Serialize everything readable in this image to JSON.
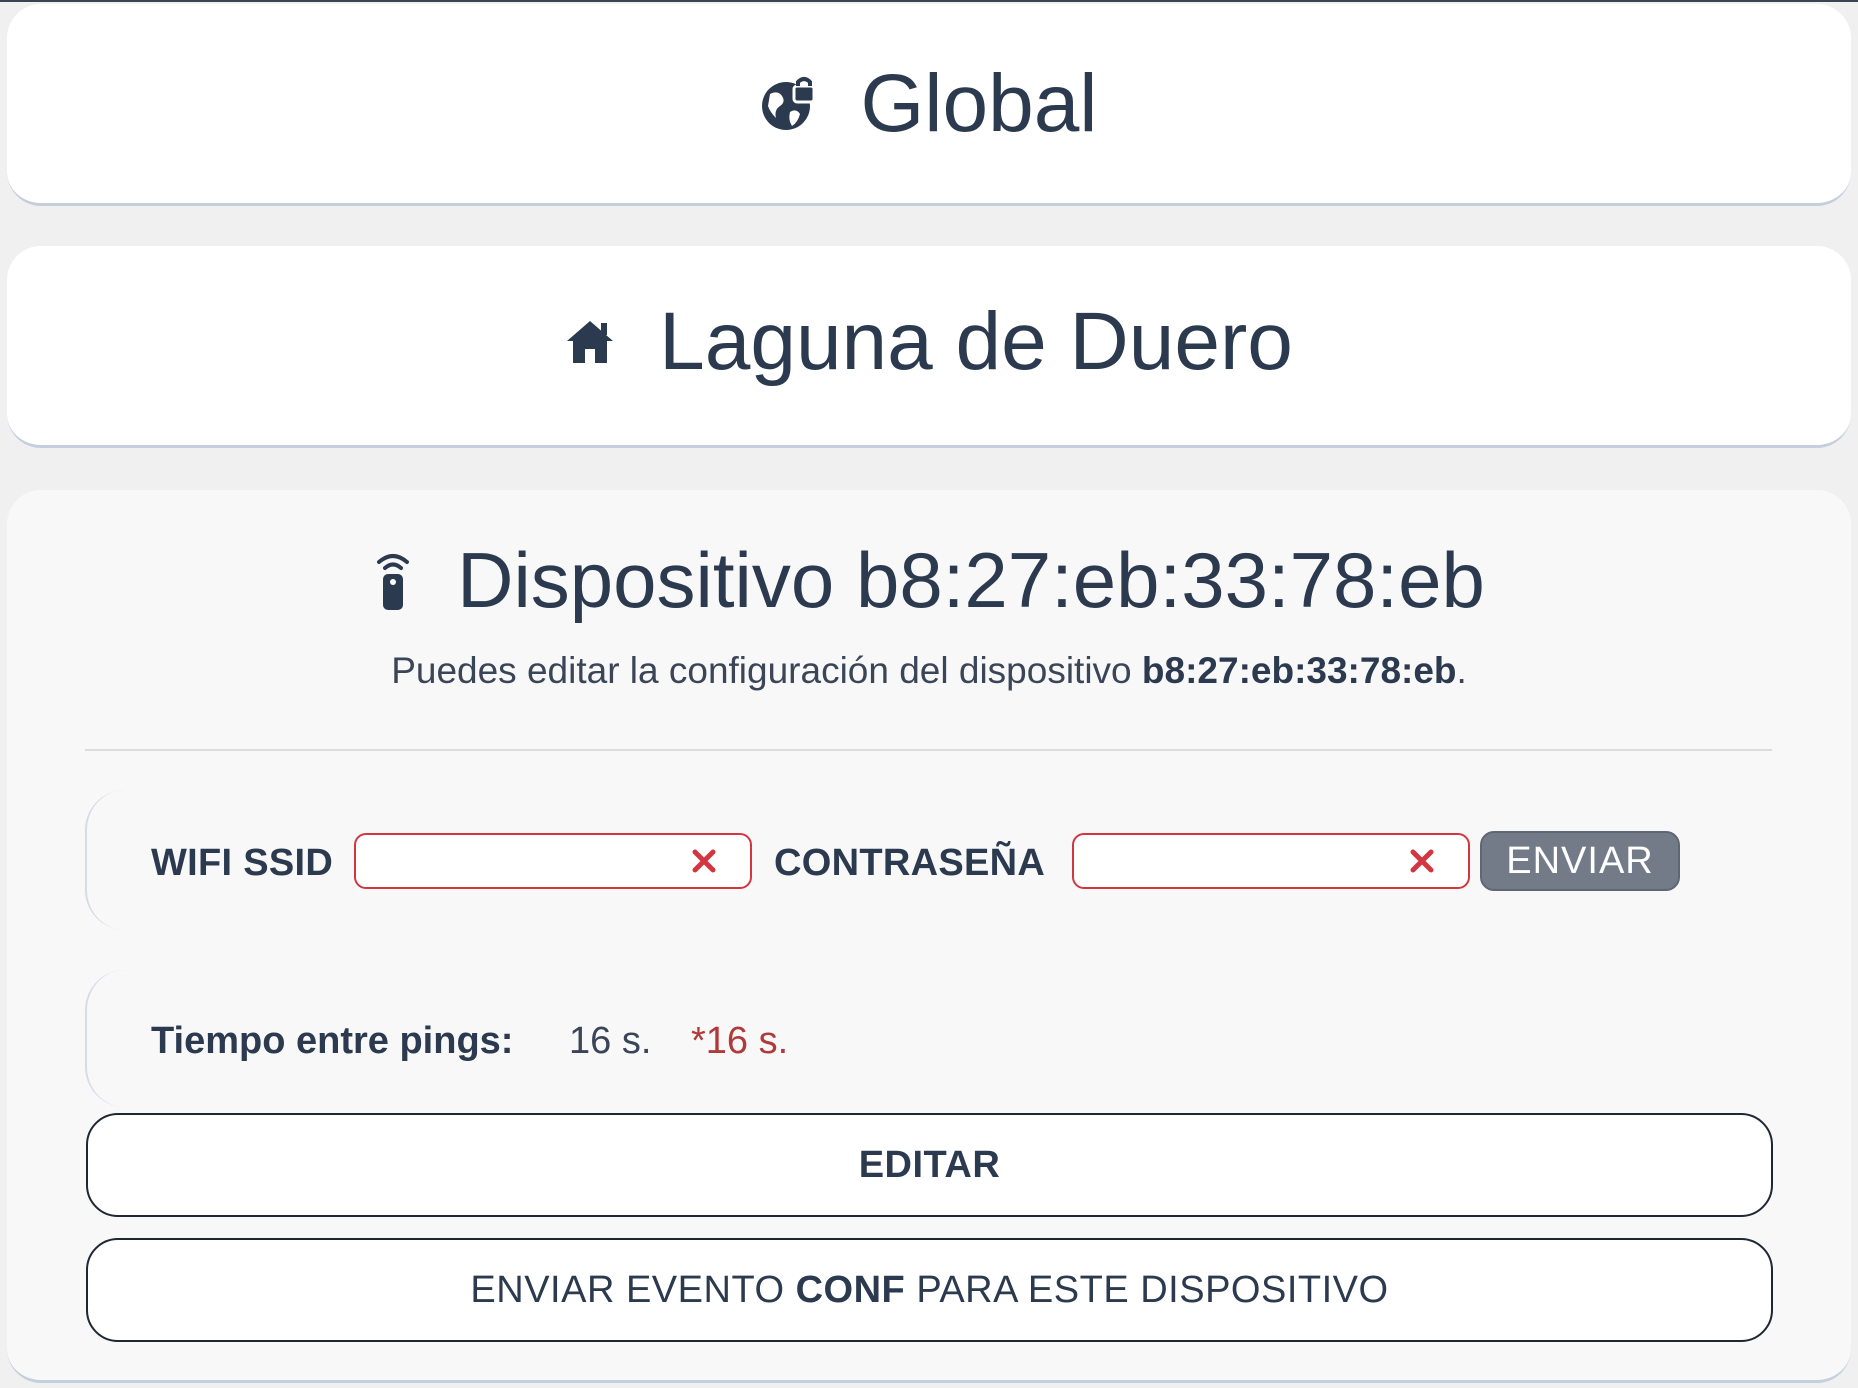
{
  "global_card": {
    "icon": "globe-lock-icon",
    "title": "Global"
  },
  "place_card": {
    "icon": "home-icon",
    "title": "Laguna de Duero"
  },
  "device_card": {
    "icon": "remote-device-icon",
    "title": "Dispositivo b8:27:eb:33:78:eb",
    "subtitle_prefix": "Puedes editar la configuración del dispositivo ",
    "subtitle_device": "b8:27:eb:33:78:eb",
    "subtitle_suffix": ".",
    "wifi": {
      "ssid_label": "WIFI SSID",
      "ssid_value": "",
      "password_label": "CONTRASEÑA",
      "password_value": "",
      "send_label": "ENVIAR"
    },
    "ping": {
      "label": "Tiempo entre pings:",
      "value": "16 s.",
      "pending_value": "*16 s."
    },
    "edit_button": "EDITAR",
    "conf_button": {
      "prefix": "ENVIAR EVENTO ",
      "bold": "CONF",
      "suffix": " PARA ESTE DISPOSITIVO"
    }
  },
  "colors": {
    "text": "#2c3a4f",
    "error_border": "#d23640",
    "pending": "#b03a3a",
    "send_button": "#737b88"
  }
}
